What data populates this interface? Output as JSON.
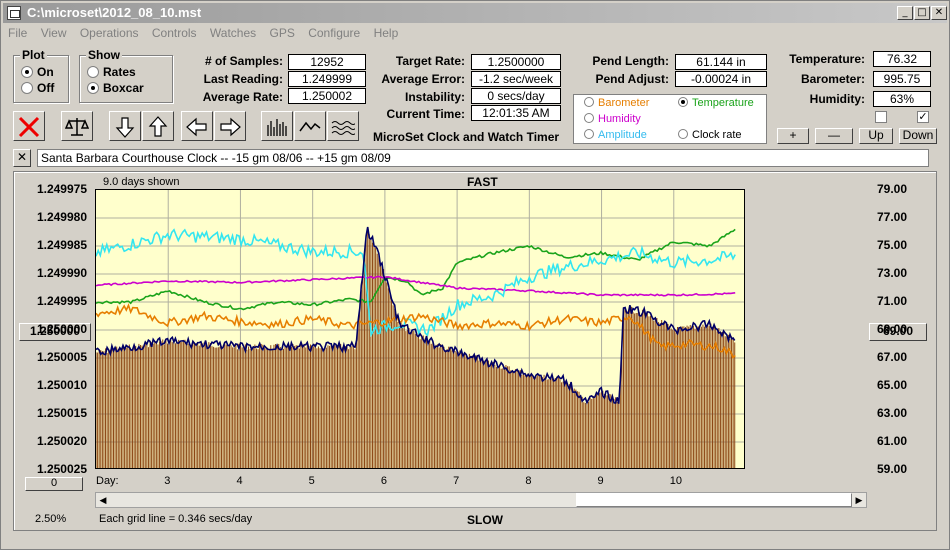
{
  "window": {
    "title": "C:\\microset\\2012_08_10.mst"
  },
  "menu": [
    "File",
    "View",
    "Operations",
    "Controls",
    "Watches",
    "GPS",
    "Configure",
    "Help"
  ],
  "plot_group": {
    "legend": "Plot",
    "on": "On",
    "off": "Off"
  },
  "show_group": {
    "legend": "Show",
    "rates": "Rates",
    "boxcar": "Boxcar"
  },
  "stats": {
    "samples_label": "# of Samples:",
    "samples": "12952",
    "last_label": "Last Reading:",
    "last": "1.249999",
    "avg_label": "Average Rate:",
    "avg": "1.250002"
  },
  "target": {
    "rate_label": "Target Rate:",
    "rate": "1.2500000",
    "error_label": "Average Error:",
    "error": "-1.2 sec/week",
    "instab_label": "Instability:",
    "instab": "0 secs/day",
    "time_label": "Current Time:",
    "time": "12:01:35 AM"
  },
  "pendulum": {
    "length_label": "Pend Length:",
    "length": "61.144 in",
    "adjust_label": "Pend Adjust:",
    "adjust": "-0.00024 in"
  },
  "environment": {
    "temp_label": "Temperature:",
    "temp": "76.32",
    "baro_label": "Barometer:",
    "baro": "995.75",
    "humid_label": "Humidity:",
    "humid": "63%"
  },
  "app_caption": "MicroSet Clock and Watch Timer",
  "options": {
    "barometer": "Barometer",
    "temperature": "Temperature",
    "humidity": "Humidity",
    "amplitude": "Amplitude",
    "clockrate": "Clock rate"
  },
  "buttons": {
    "plus": "+",
    "minus": "—",
    "up": "Up",
    "down": "Down"
  },
  "description": "Santa Barbara Courthouse Clock  --   -15 gm 08/06  --  +15 gm 08/09",
  "close_desc": "✕",
  "chart": {
    "days_shown": "9.0 days shown",
    "fast": "FAST",
    "slow": "SLOW",
    "grid_note": "Each grid line = 0.346 secs/day",
    "pct": "2.50%",
    "left_readout": "1.250000",
    "right_readout": "69.00",
    "bottom_left": "0",
    "day_label": "Day:"
  },
  "colors": {
    "temperature": "#1aa31a",
    "humidity": "#cc00cc",
    "amplitude": "#33e6f0",
    "barometer": "#e67e00",
    "rate": "#000066",
    "bars": "#8b4513",
    "plot_bg": "#ffffcc"
  },
  "chart_data": {
    "type": "line",
    "xlabel": "Day:",
    "x_ticks": [
      "3",
      "4",
      "5",
      "6",
      "7",
      "8",
      "9",
      "10"
    ],
    "y_left_ticks": [
      "1.249975",
      "1.249980",
      "1.249985",
      "1.249990",
      "1.249995",
      "1.250000",
      "1.250005",
      "1.250010",
      "1.250015",
      "1.250020",
      "1.250025"
    ],
    "y_right_ticks": [
      "79.00",
      "77.00",
      "75.00",
      "73.00",
      "71.00",
      "69.00",
      "67.00",
      "65.00",
      "63.00",
      "61.00",
      "59.00"
    ],
    "ylim_left": [
      1.249975,
      1.250025
    ],
    "ylim_right": [
      59,
      79
    ],
    "xlim": [
      2.0,
      11.0
    ],
    "grid": true,
    "series": [
      {
        "name": "Temperature",
        "axis": "right",
        "x": [
          2.0,
          2.5,
          3.0,
          3.5,
          4.0,
          4.5,
          5.0,
          5.5,
          5.8,
          6.0,
          6.3,
          6.5,
          6.8,
          7.0,
          7.5,
          8.0,
          8.5,
          9.0,
          9.5,
          10.0,
          10.5,
          10.85
        ],
        "y": [
          71.0,
          71.0,
          71.8,
          71.0,
          70.5,
          71.0,
          70.8,
          71.2,
          71.0,
          72.8,
          72.5,
          71.5,
          72.0,
          73.8,
          74.5,
          75.0,
          74.2,
          74.5,
          74.0,
          75.3,
          75.0,
          76.2
        ]
      },
      {
        "name": "Humidity",
        "axis": "right",
        "x": [
          2.0,
          3.0,
          4.0,
          5.0,
          6.0,
          7.0,
          8.0,
          9.0,
          10.0,
          10.85
        ],
        "y": [
          72.2,
          72.5,
          72.4,
          72.6,
          72.8,
          72.0,
          71.8,
          71.5,
          71.5,
          71.6
        ]
      },
      {
        "name": "Amplitude",
        "axis": "right",
        "x": [
          2.0,
          3.0,
          4.0,
          5.0,
          5.7,
          5.8,
          6.2,
          6.6,
          7.0,
          7.5,
          8.0,
          8.5,
          9.0,
          9.5,
          10.0,
          10.5,
          10.85
        ],
        "y": [
          74.5,
          75.8,
          75.5,
          74.6,
          74.6,
          69.0,
          69.5,
          69.0,
          70.8,
          71.5,
          72.8,
          73.5,
          74.0,
          74.5,
          73.8,
          74.0,
          74.3
        ]
      },
      {
        "name": "Barometer",
        "axis": "right",
        "x": [
          2.0,
          2.5,
          3.0,
          3.5,
          4.0,
          4.5,
          5.0,
          5.5,
          6.0,
          6.5,
          7.0,
          7.5,
          8.0,
          8.5,
          9.0,
          9.4,
          9.8,
          10.2,
          10.6,
          10.85
        ],
        "y": [
          70.2,
          70.5,
          69.5,
          70.0,
          69.6,
          69.4,
          69.8,
          69.3,
          69.6,
          70.0,
          69.3,
          69.5,
          69.3,
          69.8,
          69.5,
          70.0,
          67.8,
          68.0,
          67.8,
          67.2
        ]
      },
      {
        "name": "Rate",
        "axis": "left",
        "x": [
          2.0,
          3.0,
          4.0,
          5.0,
          5.6,
          5.75,
          5.9,
          6.2,
          6.6,
          7.0,
          7.5,
          8.0,
          8.5,
          8.8,
          9.0,
          9.25,
          9.3,
          9.6,
          10.0,
          10.5,
          10.85
        ],
        "y": [
          1.250004,
          1.250002,
          1.250003,
          1.250003,
          1.250003,
          1.249982,
          1.249986,
          1.249999,
          1.250002,
          1.250004,
          1.250006,
          1.250008,
          1.250009,
          1.250013,
          1.250011,
          1.250013,
          1.249996,
          1.249997,
          1.25,
          1.249999,
          1.250002
        ]
      }
    ]
  }
}
